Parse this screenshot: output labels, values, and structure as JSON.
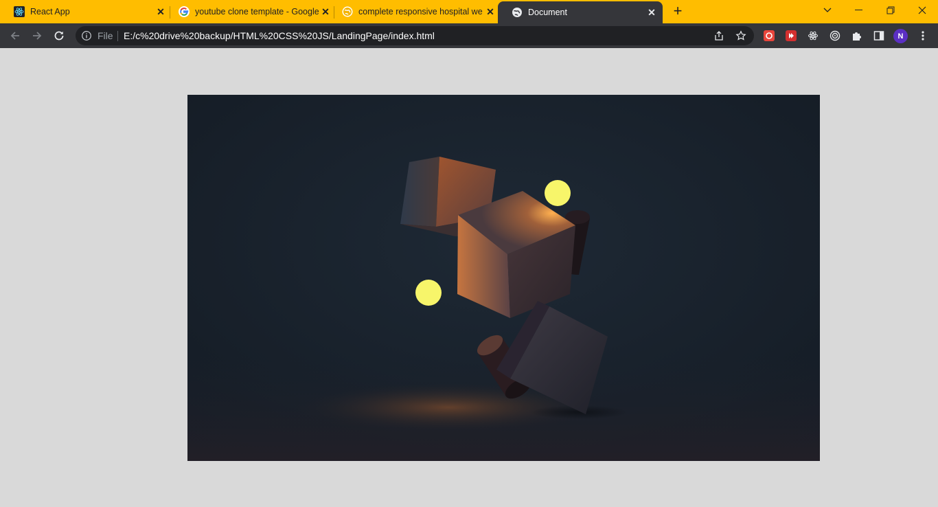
{
  "browser": {
    "tabs": [
      {
        "title": "React App",
        "favicon": "react-icon"
      },
      {
        "title": "youtube clone template - Google",
        "favicon": "google-icon"
      },
      {
        "title": "complete responsive hospital we",
        "favicon": "globe-orange-icon"
      },
      {
        "title": "Document",
        "favicon": "globe-icon",
        "active": true
      }
    ],
    "new_tab_label": "+",
    "omnibox": {
      "scheme_chip": "File",
      "url": "E:/c%20drive%20backup/HTML%20CSS%20JS/LandingPage/index.html"
    },
    "profile_initial": "N",
    "accent_color": "#ffbd00",
    "toolbar_color": "#35363a"
  },
  "page": {
    "background": "#d9d9d9",
    "hero_image": {
      "description_icon": "abstract-3d-cubes-image",
      "colors": {
        "background": "#18202a",
        "glow": "#ffa040",
        "orb": "#f7f56a"
      }
    }
  }
}
